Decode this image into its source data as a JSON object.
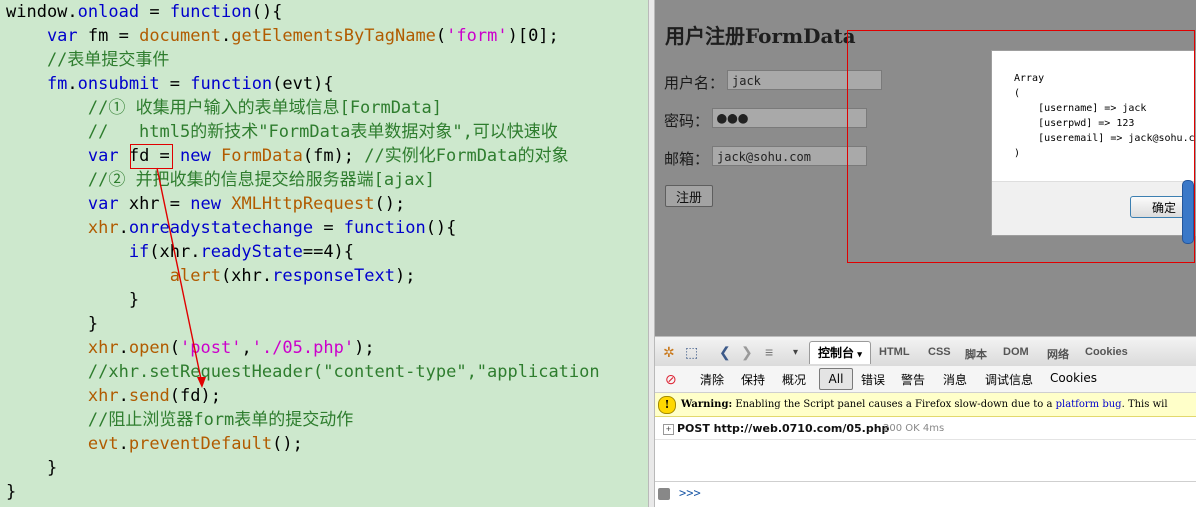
{
  "code": {
    "lines": [
      [
        {
          "t": "window",
          "c": "ident"
        },
        {
          "t": ".",
          "c": "ident"
        },
        {
          "t": "onload",
          "c": "kw"
        },
        {
          "t": " = ",
          "c": "ident"
        },
        {
          "t": "function",
          "c": "kw"
        },
        {
          "t": "(){",
          "c": "paren"
        }
      ],
      [
        {
          "t": "    var",
          "c": "kw"
        },
        {
          "t": " fm = ",
          "c": "ident"
        },
        {
          "t": "document",
          "c": "method"
        },
        {
          "t": ".",
          "c": "ident"
        },
        {
          "t": "getElementsByTagName",
          "c": "method"
        },
        {
          "t": "(",
          "c": "paren"
        },
        {
          "t": "'form'",
          "c": "string"
        },
        {
          "t": ")[0];",
          "c": "paren"
        }
      ],
      [
        {
          "t": "    //表单提交事件",
          "c": "comment"
        }
      ],
      [
        {
          "t": "    fm",
          "c": "kw"
        },
        {
          "t": ".",
          "c": "ident"
        },
        {
          "t": "onsubmit",
          "c": "kw"
        },
        {
          "t": " = ",
          "c": "ident"
        },
        {
          "t": "function",
          "c": "kw"
        },
        {
          "t": "(evt){",
          "c": "paren"
        }
      ],
      [
        {
          "t": "        //① 收集用户输入的表单域信息[FormData]",
          "c": "comment"
        }
      ],
      [
        {
          "t": "        //   html5的新技术\"FormData表单数据对象\",可以快速收",
          "c": "comment"
        }
      ],
      [
        {
          "t": "        var",
          "c": "kw"
        },
        {
          "t": " fd = ",
          "c": "ident"
        },
        {
          "t": "new",
          "c": "kw"
        },
        {
          "t": " FormData",
          "c": "class"
        },
        {
          "t": "(fm); ",
          "c": "paren"
        },
        {
          "t": "//实例化FormData的对象",
          "c": "comment"
        }
      ],
      [
        {
          "t": "        //② 并把收集的信息提交给服务器端[ajax]",
          "c": "comment"
        }
      ],
      [
        {
          "t": "        var",
          "c": "kw"
        },
        {
          "t": " xhr = ",
          "c": "ident"
        },
        {
          "t": "new",
          "c": "kw"
        },
        {
          "t": " XMLHttpRequest",
          "c": "class"
        },
        {
          "t": "();",
          "c": "paren"
        }
      ],
      [
        {
          "t": "        xhr",
          "c": "method"
        },
        {
          "t": ".",
          "c": "ident"
        },
        {
          "t": "onreadystatechange",
          "c": "kw"
        },
        {
          "t": " = ",
          "c": "ident"
        },
        {
          "t": "function",
          "c": "kw"
        },
        {
          "t": "(){",
          "c": "paren"
        }
      ],
      [
        {
          "t": "            if",
          "c": "kw"
        },
        {
          "t": "(xhr.",
          "c": "paren"
        },
        {
          "t": "readyState",
          "c": "kw"
        },
        {
          "t": "==4){",
          "c": "paren"
        }
      ],
      [
        {
          "t": "                alert",
          "c": "method"
        },
        {
          "t": "(xhr.",
          "c": "paren"
        },
        {
          "t": "responseText",
          "c": "kw"
        },
        {
          "t": ");",
          "c": "paren"
        }
      ],
      [
        {
          "t": "            }",
          "c": "paren"
        }
      ],
      [
        {
          "t": "        }",
          "c": "paren"
        }
      ],
      [
        {
          "t": "        xhr",
          "c": "method"
        },
        {
          "t": ".",
          "c": "ident"
        },
        {
          "t": "open",
          "c": "method"
        },
        {
          "t": "(",
          "c": "paren"
        },
        {
          "t": "'post'",
          "c": "string"
        },
        {
          "t": ",",
          "c": "paren"
        },
        {
          "t": "'./05.php'",
          "c": "string"
        },
        {
          "t": ");",
          "c": "paren"
        }
      ],
      [
        {
          "t": "        //xhr.setRequestHeader(\"content-type\",\"application",
          "c": "comment"
        }
      ],
      [
        {
          "t": "        xhr",
          "c": "method"
        },
        {
          "t": ".",
          "c": "ident"
        },
        {
          "t": "send",
          "c": "method"
        },
        {
          "t": "(fd);",
          "c": "paren"
        }
      ],
      [
        {
          "t": "        //阻止浏览器form表单的提交动作",
          "c": "comment"
        }
      ],
      [
        {
          "t": "        evt",
          "c": "method"
        },
        {
          "t": ".",
          "c": "ident"
        },
        {
          "t": "preventDefault",
          "c": "method"
        },
        {
          "t": "();",
          "c": "paren"
        }
      ],
      [
        {
          "t": "    }",
          "c": "paren"
        }
      ],
      [
        {
          "t": "}",
          "c": "paren"
        }
      ]
    ]
  },
  "page": {
    "title": "用户注册FormData",
    "username_label": "用户名：",
    "username_value": "jack",
    "password_label": "密码：",
    "password_dots": "●●●",
    "email_label": "邮箱：",
    "email_value": "jack@sohu.com",
    "register_label": "注册"
  },
  "alert": {
    "text": "Array\n(\n    [username] => jack\n    [userpwd] => 123\n    [useremail] => jack@sohu.com\n)",
    "ok_label": "确定"
  },
  "firebug": {
    "console_tab": "控制台",
    "tabs": [
      "HTML",
      "CSS",
      "脚本",
      "DOM",
      "网络",
      "Cookies"
    ],
    "sub_clear": "清除",
    "sub_persist": "保持",
    "sub_profile": "概况",
    "sub_all": "All",
    "sub_filters": [
      "错误",
      "警告",
      "消息",
      "调试信息",
      "Cookies"
    ],
    "warning_label": "Warning:",
    "warning_text": " Enabling the Script panel causes a Firefox slow-down due to a ",
    "warning_link": "platform bug",
    "warning_tail": ". This wil",
    "request_main": "POST http://web.0710.com/05.php",
    "request_status": "200 OK 4ms",
    "cmd_prompt": ">>>"
  },
  "colors": {
    "code_bg": "#cde8cd",
    "keyword": "#0000cc",
    "method": "#b15b00",
    "string": "#cc00cc",
    "comment": "#2e7d2e",
    "annotation_red": "#e00000"
  }
}
